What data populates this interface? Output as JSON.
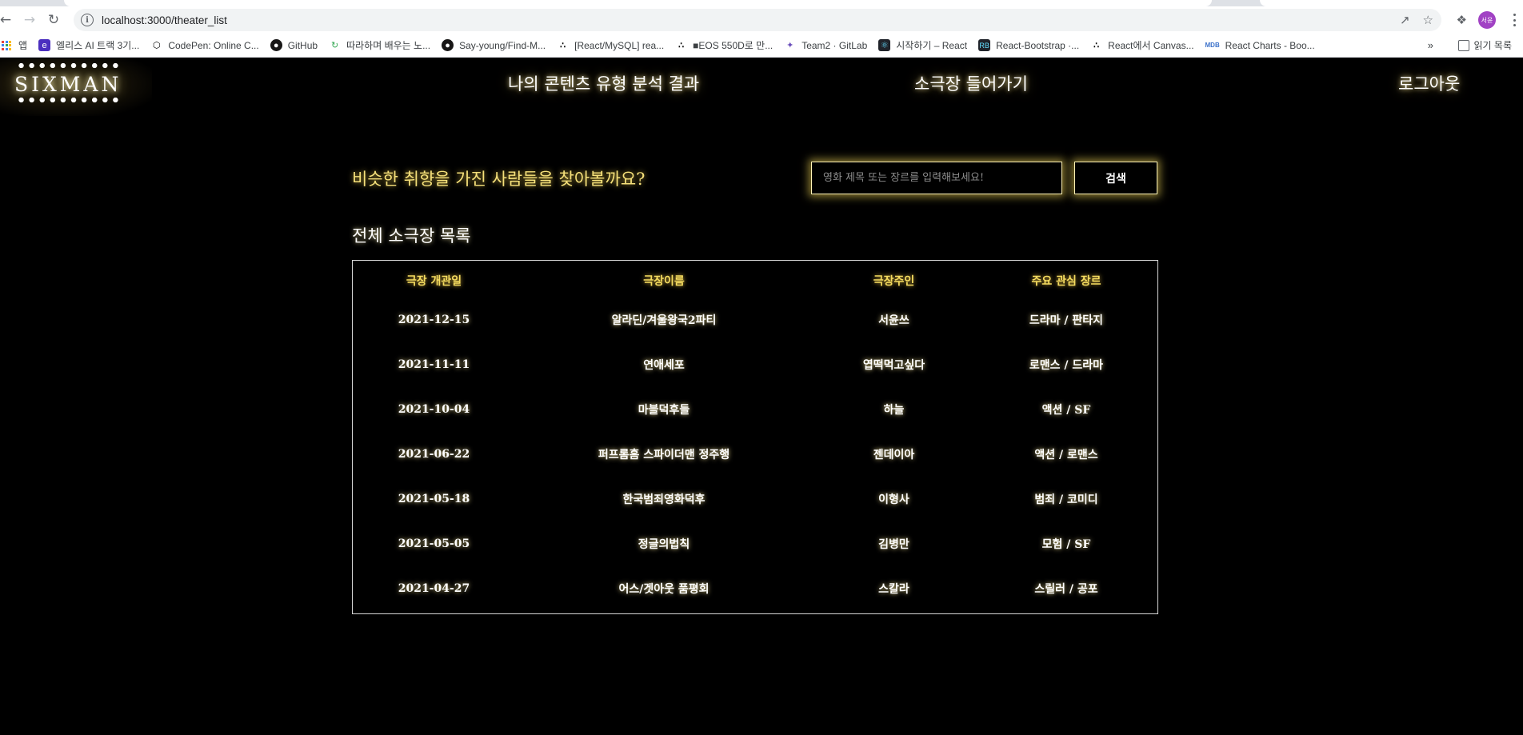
{
  "browser": {
    "url": "localhost:3000/theater_list",
    "avatar_text": "서윤",
    "bookmarks": [
      {
        "label": "앱",
        "icon": "apps-grid-icon"
      },
      {
        "label": "엘리스 AI 트랙 3기...",
        "icon": "elice-icon"
      },
      {
        "label": "CodePen: Online C...",
        "icon": "codepen-icon"
      },
      {
        "label": "GitHub",
        "icon": "github-icon"
      },
      {
        "label": "따라하며 배우는 노...",
        "icon": "refresh-icon"
      },
      {
        "label": "Say-young/Find-M...",
        "icon": "github-icon"
      },
      {
        "label": "[React/MySQL] rea...",
        "icon": "velog-icon"
      },
      {
        "label": "■EOS 550D로 만...",
        "icon": "velog-icon"
      },
      {
        "label": "Team2 · GitLab",
        "icon": "gitlab-icon"
      },
      {
        "label": "시작하기 – React",
        "icon": "react-icon"
      },
      {
        "label": "React-Bootstrap ·...",
        "icon": "bootstrap-icon"
      },
      {
        "label": "React에서 Canvas...",
        "icon": "velog-icon"
      },
      {
        "label": "React Charts - Boo...",
        "icon": "mdb-icon"
      }
    ],
    "more_label": "»",
    "reading_list_label": "읽기 목록"
  },
  "app": {
    "logo_text": "SIXMAN",
    "nav": {
      "analysis": "나의 콘텐츠 유형 분석 결과",
      "enter_theater": "소극장 들어가기",
      "logout": "로그아웃"
    },
    "search": {
      "prompt": "비슷한 취향을 가진 사람들을 찾아볼까요?",
      "placeholder": "영화 제목 또는 장르를 입력해보세요!",
      "button": "검색"
    },
    "list_title": "전체 소극장 목록",
    "table": {
      "headers": [
        "극장 개관일",
        "극장이름",
        "극장주인",
        "주요 관심 장르"
      ],
      "rows": [
        [
          "2021-12-15",
          "알라딘/겨울왕국2파티",
          "서윤쓰",
          "드라마 / 판타지"
        ],
        [
          "2021-11-11",
          "연애세포",
          "엽떡먹고싶다",
          "로맨스 / 드라마"
        ],
        [
          "2021-10-04",
          "마블덕후들",
          "하늘",
          "액션 / SF"
        ],
        [
          "2021-06-22",
          "퍼프롬홈 스파이더맨 정주행",
          "젠데이아",
          "액션 / 로맨스"
        ],
        [
          "2021-05-18",
          "한국범죄영화덕후",
          "이형사",
          "범죄 / 코미디"
        ],
        [
          "2021-05-05",
          "정글의법칙",
          "김병만",
          "모험 / SF"
        ],
        [
          "2021-04-27",
          "어스/겟아웃 품평회",
          "스칼라",
          "스릴러 / 공포"
        ]
      ]
    }
  }
}
